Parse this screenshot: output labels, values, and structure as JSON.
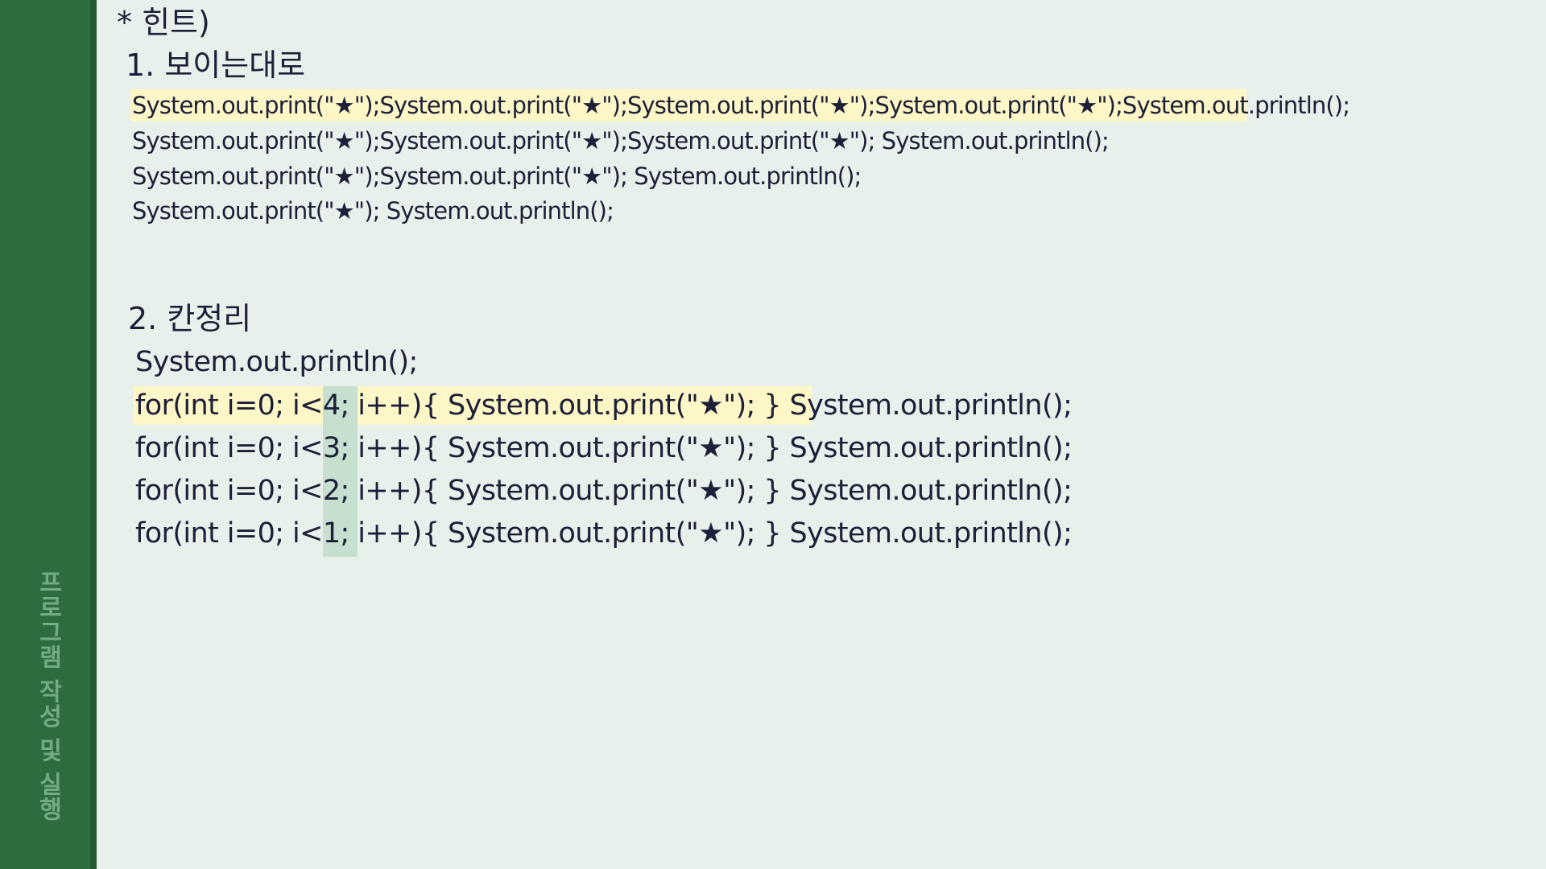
{
  "sidebar": {
    "title": "프로그램 작성 및 실행"
  },
  "hint": {
    "title": "* 힌트)"
  },
  "section1": {
    "heading": "1. 보이는대로",
    "lines": [
      "System.out.print(\"★\");System.out.print(\"★\");System.out.print(\"★\");System.out.print(\"★\");System.out.println();",
      "System.out.print(\"★\");System.out.print(\"★\");System.out.print(\"★\"); System.out.println();",
      "System.out.print(\"★\");System.out.print(\"★\"); System.out.println();",
      "System.out.print(\"★\"); System.out.println();"
    ]
  },
  "section2": {
    "heading": "2. 칸정리",
    "lines": [
      "System.out.println();",
      "for(int i=0; i<4; i++){ System.out.print(\"★\"); } System.out.println();",
      "for(int i=0; i<3; i++){ System.out.print(\"★\"); } System.out.println();",
      "for(int i=0; i<2; i++){ System.out.print(\"★\"); } System.out.println();",
      "for(int i=0; i<1; i++){ System.out.print(\"★\"); } System.out.println();"
    ]
  },
  "colors": {
    "sidebar": "#2e6b3e",
    "background": "#e8f0eb",
    "highlight_yellow": "#fdf6c6",
    "highlight_green": "#c7dfcf",
    "text": "#1c2038"
  }
}
